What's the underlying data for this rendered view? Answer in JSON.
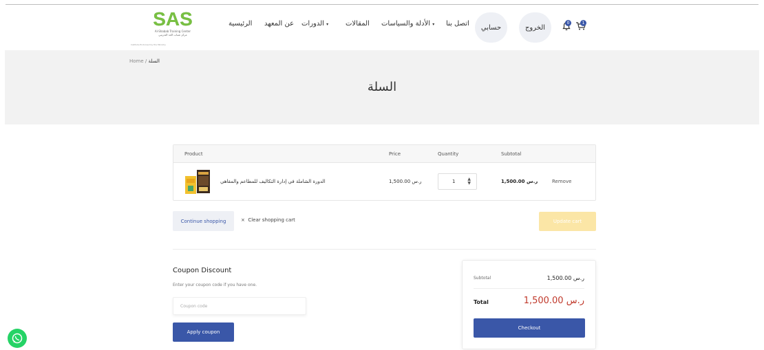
{
  "header": {
    "logo": {
      "mark": "SAS",
      "line1": "Al-Shabab Training Center",
      "line2": "مركز شباب الغد التدريبي",
      "tagline": "Institute Endorsed by the Ministry"
    },
    "nav": {
      "home": "الرئيسية",
      "about": "عن المعهد",
      "courses": "الدورات",
      "articles": "المقالات",
      "guides": "الأدلة والسياسات",
      "contact": "اتصل بنا"
    },
    "account_label": "حسابي",
    "logout_label": "الخروج",
    "notifications_count": "0",
    "cart_count": "1"
  },
  "breadcrumb": {
    "home": "Home",
    "sep": "/",
    "current": "السلة"
  },
  "page_title": "السلة",
  "cart": {
    "headers": {
      "product": "Product",
      "price": "Price",
      "quantity": "Quantity",
      "subtotal": "Subtotal"
    },
    "rows": [
      {
        "name": "الدورة الشاملة في إدارة التكاليف للمطاعم والمقاهي",
        "price": "1,500.00 ر.س",
        "quantity": "1",
        "subtotal": "1,500.00 ر.س",
        "remove": "Remove"
      }
    ]
  },
  "actions": {
    "continue": "Continue shopping",
    "clear": "Clear shopping cart",
    "clear_icon": "×",
    "update": "Update cart"
  },
  "coupon": {
    "title": "Coupon Discount",
    "description": "Enter your coupon code if you have one.",
    "placeholder": "Coupon code",
    "apply": "Apply coupon"
  },
  "totals": {
    "subtotal_label": "Subtotal",
    "subtotal_value": "1,500.00 ر.س",
    "total_label": "Total",
    "total_value": "1,500.00 ر.س",
    "checkout": "Checkout"
  },
  "colors": {
    "primary": "#3a57a8",
    "accent_red": "#c0392b",
    "update_disabled": "#fbe6a6",
    "whatsapp": "#25d366"
  }
}
